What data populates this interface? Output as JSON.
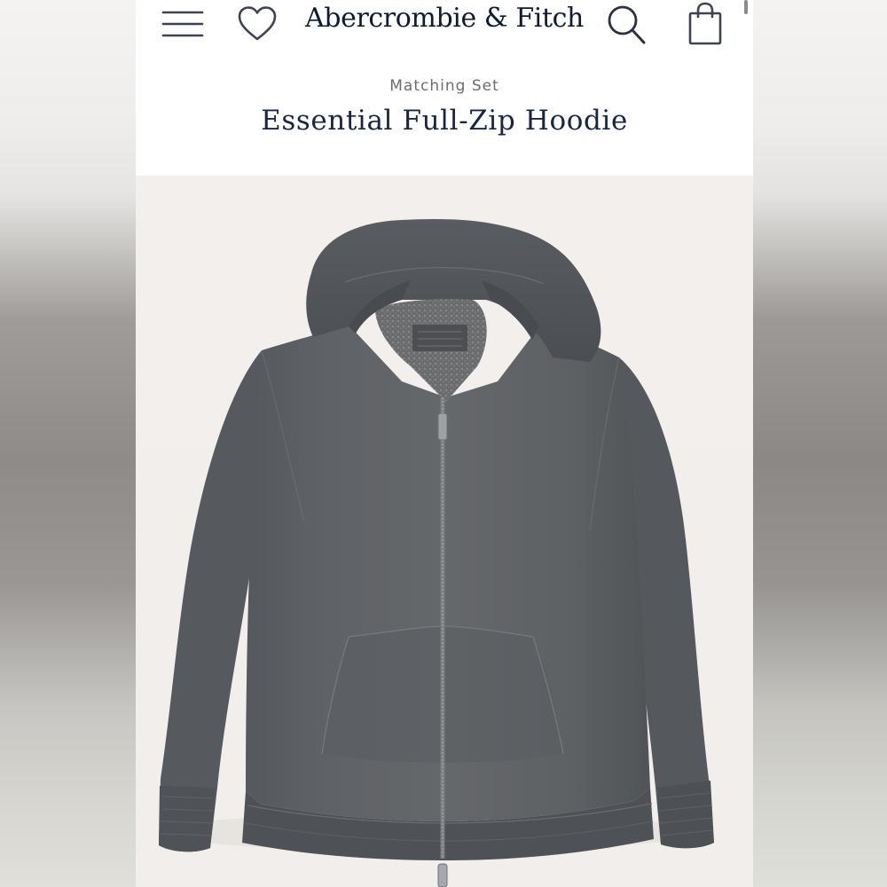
{
  "header": {
    "brand": "Abercrombie & Fitch",
    "menu_icon": "hamburger-menu-icon",
    "favorites_icon": "heart-icon",
    "search_icon": "search-icon",
    "bag_icon": "shopping-bag-icon"
  },
  "product": {
    "eyebrow": "Matching Set",
    "title": "Essential Full-Zip Hoodie",
    "image_subject": "dark grey full-zip hoodie",
    "garment_color": "#5e6164"
  },
  "colors": {
    "brand_navy": "#0f1b33",
    "eyebrow_grey": "#6e6e72",
    "image_background": "#f2eeec"
  }
}
